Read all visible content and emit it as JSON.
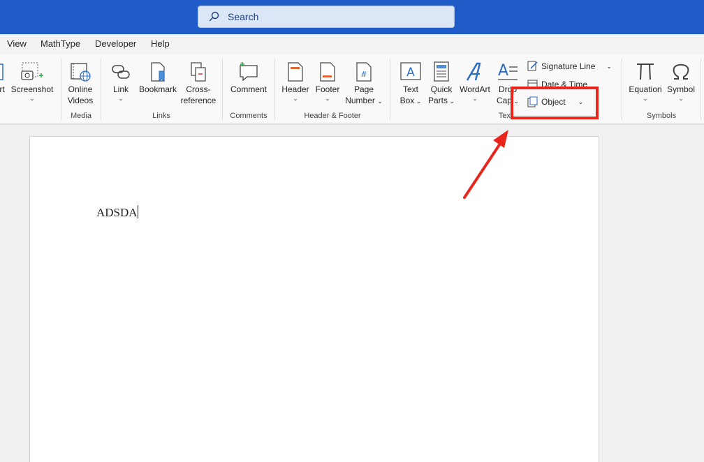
{
  "titlebar": {
    "search_placeholder": "Search"
  },
  "menu": [
    "View",
    "MathType",
    "Developer",
    "Help"
  ],
  "ribbon": {
    "screenshot": {
      "label": "Screenshot"
    },
    "online_videos": {
      "label1": "Online",
      "label2": "Videos"
    },
    "link": {
      "label": "Link"
    },
    "bookmark": {
      "label": "Bookmark"
    },
    "cross_reference": {
      "label1": "Cross-",
      "label2": "reference"
    },
    "comment": {
      "label": "Comment"
    },
    "header": {
      "label": "Header"
    },
    "footer": {
      "label": "Footer"
    },
    "page_number": {
      "label1": "Page",
      "label2": "Number"
    },
    "text_box": {
      "label1": "Text",
      "label2": "Box"
    },
    "quick_parts": {
      "label1": "Quick",
      "label2": "Parts"
    },
    "wordart": {
      "label": "WordArt"
    },
    "drop_cap": {
      "label1": "Drop",
      "label2": "Cap"
    },
    "signature_line": {
      "label": "Signature Line"
    },
    "date_time": {
      "label": "Date & Time"
    },
    "object": {
      "label": "Object"
    },
    "equation": {
      "label": "Equation"
    },
    "symbol": {
      "label": "Symbol"
    },
    "groups": {
      "media": "Media",
      "links": "Links",
      "comments": "Comments",
      "header_footer": "Header & Footer",
      "text": "Text",
      "symbols": "Symbols"
    },
    "partial_left_label": "rt"
  },
  "document": {
    "text": "ADSDA"
  },
  "colors": {
    "titlebar": "#1e5bc6",
    "highlight": "#e8261c",
    "accent_icon": "#2b6cc4"
  }
}
